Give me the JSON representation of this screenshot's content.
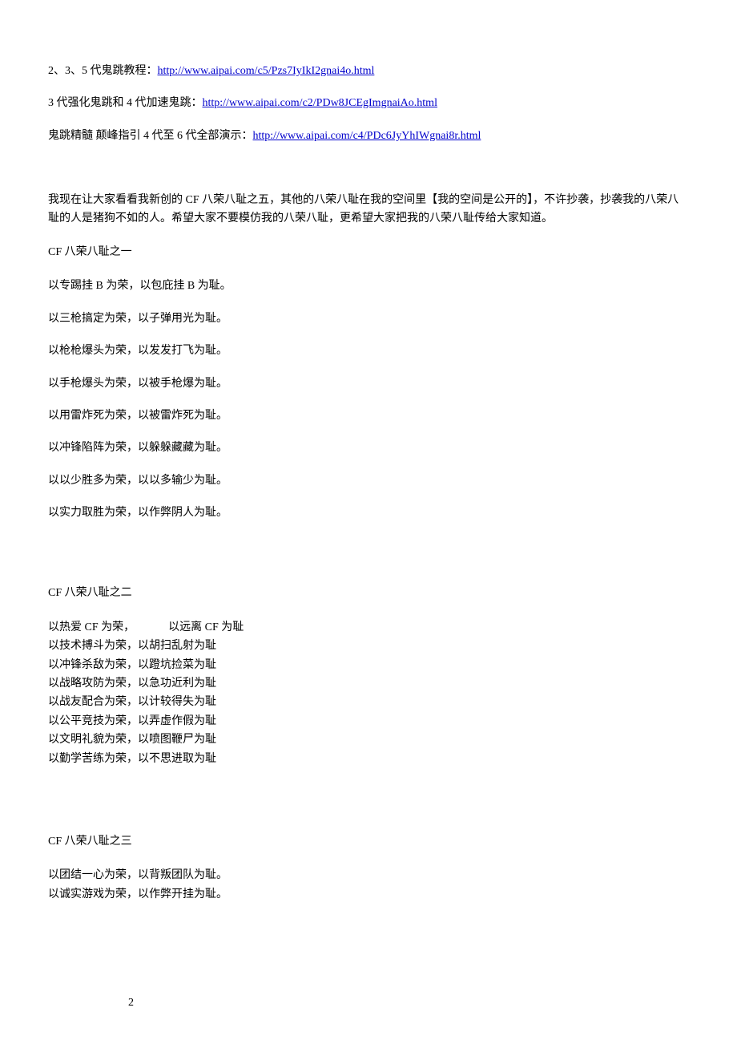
{
  "links": {
    "l1_prefix": "2、3、5 代鬼跳教程：",
    "l1_url": "http://www.aipai.com/c5/Pzs7IyIkI2gnai4o.html",
    "l2_prefix": "3 代强化鬼跳和 4 代加速鬼跳：",
    "l2_url": "http://www.aipai.com/c2/PDw8JCEgImgnaiAo.html",
    "l3_prefix": "鬼跳精髓 颠峰指引 4 代至 6 代全部演示：",
    "l3_url": "http://www.aipai.com/c4/PDc6JyYhIWgnai8r.html"
  },
  "intro": "我现在让大家看看我新创的 CF 八荣八耻之五，其他的八荣八耻在我的空间里【我的空间是公开的】，不许抄袭，抄袭我的八荣八耻的人是猪狗不如的人。希望大家不要模仿我的八荣八耻，更希望大家把我的八荣八耻传给大家知道。",
  "sections": [
    {
      "title": "CF 八荣八耻之一",
      "lines": [
        "以专踢挂 B 为荣，以包庇挂 B 为耻。",
        "以三枪搞定为荣，以子弹用光为耻。",
        "以枪枪爆头为荣，以发发打飞为耻。",
        "以手枪爆头为荣，以被手枪爆为耻。",
        "以用雷炸死为荣，以被雷炸死为耻。",
        "以冲锋陷阵为荣，以躲躲藏藏为耻。",
        "以以少胜多为荣，以以多输少为耻。",
        "以实力取胜为荣，以作弊阴人为耻。"
      ],
      "spaced": true
    },
    {
      "title": "CF 八荣八耻之二",
      "lines": [
        "以热爱 CF 为荣，   以远离 CF 为耻",
        "以技术搏斗为荣，以胡扫乱射为耻",
        "以冲锋杀敌为荣，以蹬坑捡菜为耻",
        "以战略攻防为荣，以急功近利为耻",
        "以战友配合为荣，以计较得失为耻",
        "以公平竞技为荣，以弄虚作假为耻",
        "以文明礼貌为荣，以喷图鞭尸为耻",
        "以勤学苦练为荣，以不思进取为耻"
      ],
      "spaced": false
    },
    {
      "title": "CF 八荣八耻之三",
      "lines": [
        "以团结一心为荣，以背叛团队为耻。",
        "以诚实游戏为荣，以作弊开挂为耻。"
      ],
      "spaced": false
    }
  ],
  "page_number": "2"
}
